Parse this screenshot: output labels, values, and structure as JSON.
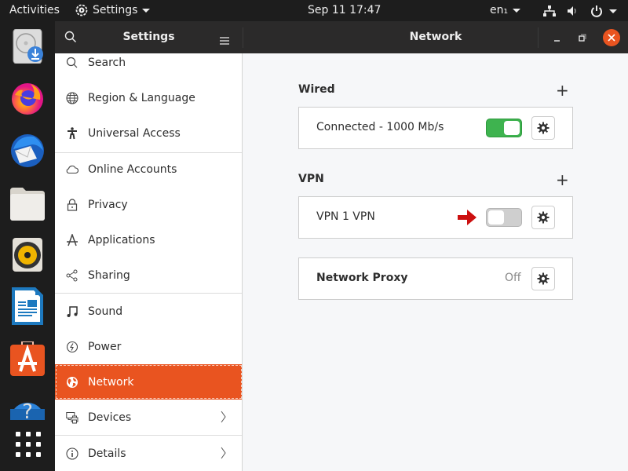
{
  "topbar": {
    "activities": "Activities",
    "app_menu": "Settings",
    "datetime": "Sep 11  17:47",
    "keyboard": "en₁"
  },
  "dock": {
    "apps": [
      "Disk Installer",
      "Firefox",
      "Thunderbird",
      "Files",
      "Rhythmbox",
      "LibreOffice Writer",
      "Ubuntu Software",
      "Help",
      "Show Applications"
    ]
  },
  "header": {
    "sidebar_title": "Settings",
    "page_title": "Network"
  },
  "sidebar": {
    "items": [
      {
        "label": "Search",
        "icon": "search-icon"
      },
      {
        "label": "Region & Language",
        "icon": "globe-icon"
      },
      {
        "label": "Universal Access",
        "icon": "accessibility-icon"
      },
      {
        "label": "Online Accounts",
        "icon": "cloud-icon"
      },
      {
        "label": "Privacy",
        "icon": "lock-icon"
      },
      {
        "label": "Applications",
        "icon": "applications-icon"
      },
      {
        "label": "Sharing",
        "icon": "share-icon"
      },
      {
        "label": "Sound",
        "icon": "music-note-icon"
      },
      {
        "label": "Power",
        "icon": "power-icon"
      },
      {
        "label": "Network",
        "icon": "network-globe-icon",
        "active": true
      },
      {
        "label": "Devices",
        "icon": "devices-icon",
        "has_submenu": true
      },
      {
        "label": "Details",
        "icon": "info-icon",
        "has_submenu": true
      }
    ]
  },
  "main": {
    "wired": {
      "title": "Wired",
      "connection": "Connected - 1000 Mb/s",
      "enabled": true
    },
    "vpn": {
      "title": "VPN",
      "connection": "VPN 1 VPN",
      "enabled": false
    },
    "proxy": {
      "label": "Network Proxy",
      "status": "Off"
    }
  },
  "colors": {
    "accent": "#e95420",
    "switch_on": "#3eb34f",
    "switch_off": "#cfcfcf",
    "arrow": "#cc1010"
  }
}
